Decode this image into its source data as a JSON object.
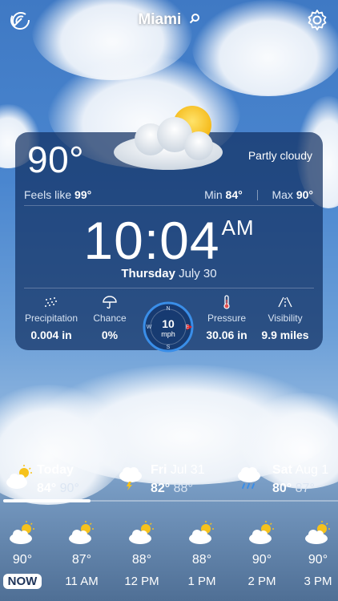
{
  "header": {
    "city": "Miami"
  },
  "current": {
    "temp": "90°",
    "condition": "Partly cloudy",
    "feels_label": "Feels like",
    "feels_value": "99°",
    "min_label": "Min",
    "min_value": "84°",
    "max_label": "Max",
    "max_value": "90°",
    "time": "10:04",
    "ampm": "AM",
    "weekday": "Thursday",
    "date": "July 30"
  },
  "stats": {
    "precipitation": {
      "label": "Precipitation",
      "value": "0.004 in"
    },
    "chance": {
      "label": "Chance",
      "value": "0%"
    },
    "wind": {
      "value": "10",
      "unit": "mph",
      "n": "N",
      "s": "S",
      "w": "W",
      "e": "E"
    },
    "pressure": {
      "label": "Pressure",
      "value": "30.06 in"
    },
    "visibility": {
      "label": "Visibility",
      "value": "9.9 miles"
    }
  },
  "daily": [
    {
      "day": "Today",
      "date": "",
      "hi": "84°",
      "lo": "90°",
      "icon": "partly-cloudy-icon"
    },
    {
      "day": "Fri",
      "date": "Jul 31",
      "hi": "82°",
      "lo": "88°",
      "icon": "thunderstorm-icon"
    },
    {
      "day": "Sat",
      "date": "Aug 1",
      "hi": "80°",
      "lo": "87°",
      "icon": "rain-icon"
    }
  ],
  "daily_scroll_fraction": 0.26,
  "hourly": [
    {
      "temp": "90°",
      "label": "NOW",
      "icon": "partly-cloudy-icon"
    },
    {
      "temp": "87°",
      "label": "11 AM",
      "icon": "partly-cloudy-icon"
    },
    {
      "temp": "88°",
      "label": "12 PM",
      "icon": "partly-cloudy-icon"
    },
    {
      "temp": "88°",
      "label": "1 PM",
      "icon": "partly-cloudy-icon"
    },
    {
      "temp": "90°",
      "label": "2 PM",
      "icon": "partly-cloudy-icon"
    },
    {
      "temp": "90°",
      "label": "3 PM",
      "icon": "partly-cloudy-icon"
    }
  ],
  "colors": {
    "accent_sun": "#f6c21c",
    "card": "#12306280",
    "wind_marker": "#e02020"
  }
}
